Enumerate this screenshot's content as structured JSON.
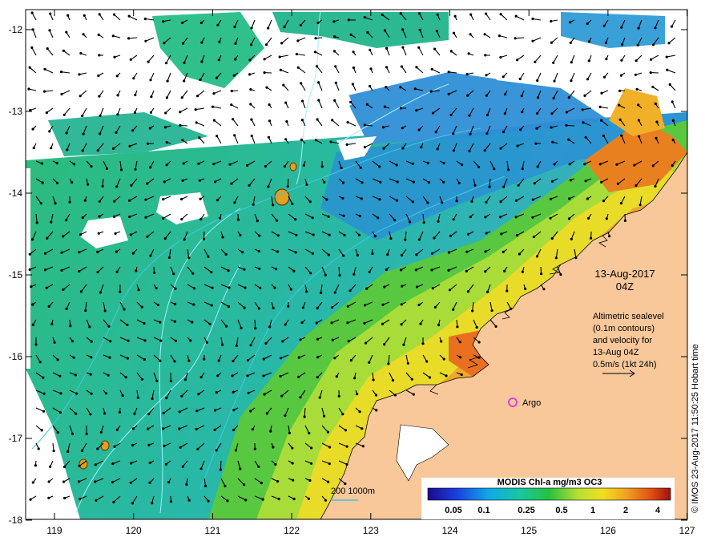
{
  "map": {
    "lat_ticks": [
      "-12",
      "-13",
      "-14",
      "-15",
      "-16",
      "-17",
      "-18"
    ],
    "lon_ticks": [
      "119",
      "120",
      "121",
      "122",
      "123",
      "124",
      "125",
      "126",
      "127"
    ],
    "date": "13-Aug-2017",
    "time": "04Z",
    "info_lines": [
      "Altimetric sealevel",
      "(0.1m contours)",
      "and velocity for",
      "13-Aug 04Z",
      "0.5m/s (1kt 24h)"
    ],
    "argo_label": "Argo",
    "depth_legend": "200  1000m",
    "colorbar_title": "MODIS Chl-a mg/m3 OC3",
    "colorbar_labels": [
      "0.05",
      "0.1",
      "0.25",
      "0.5",
      "1",
      "2",
      "4"
    ],
    "credit": "© IMOS 23-Aug-2017 11:50:25 Hobart time"
  },
  "colors": {
    "land": "#f8c89a",
    "argo": "#e040e0",
    "contour": "#9ef0ff",
    "depth_line": "#40c8e8"
  }
}
